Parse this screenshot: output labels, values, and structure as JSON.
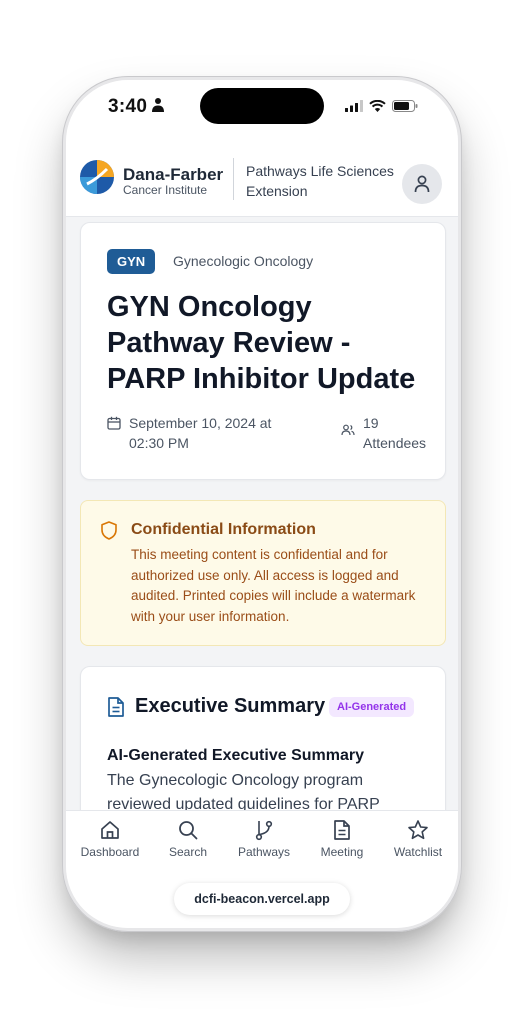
{
  "status_bar": {
    "time": "3:40"
  },
  "header": {
    "logo_title": "Dana-Farber",
    "logo_subtitle": "Cancer Institute",
    "extension_line1": "Pathways Life Sciences",
    "extension_line2": "Extension"
  },
  "meeting": {
    "badge": "GYN",
    "specialty": "Gynecologic Oncology",
    "title": "GYN Oncology Pathway Review - PARP Inhibitor Update",
    "date": "September 10, 2024 at 02:30 PM",
    "attendees": "19 Attendees"
  },
  "alert": {
    "title": "Confidential Information",
    "body": "This meeting content is confidential and for authorized use only. All access is logged and audited. Printed copies will include a watermark with your user information."
  },
  "summary": {
    "title": "Executive Summary",
    "ai_badge": "AI-Generated",
    "heading": "AI-Generated Executive Summary",
    "text": "The Gynecologic Oncology program reviewed updated guidelines for PARP"
  },
  "tabs": [
    {
      "label": "Dashboard",
      "icon": "home-icon"
    },
    {
      "label": "Search",
      "icon": "search-icon"
    },
    {
      "label": "Pathways",
      "icon": "git-branch-icon"
    },
    {
      "label": "Meeting",
      "icon": "document-icon"
    },
    {
      "label": "Watchlist",
      "icon": "star-icon"
    }
  ],
  "browser": {
    "url": "dcfi-beacon.vercel.app"
  },
  "colors": {
    "badge_blue": "#1f5c96",
    "alert_bg": "#fefae8",
    "alert_text": "#9a4d18",
    "ai_badge_bg": "#f3e8ff",
    "ai_badge_text": "#9333ea"
  }
}
